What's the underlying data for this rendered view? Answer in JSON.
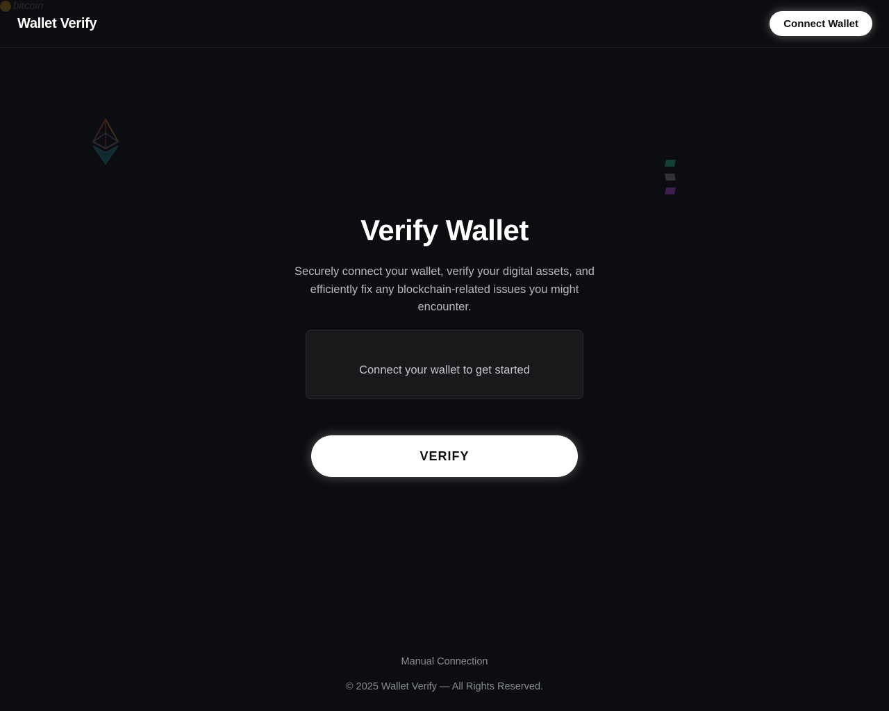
{
  "header": {
    "brand": "Wallet Verify",
    "connect_label": "Connect Wallet"
  },
  "decorations": {
    "ethereum_icon": "ethereum-logo",
    "solana_icon": "solana-logo",
    "bitcoin_icon": "bitcoin-logo",
    "bitcoin_word": "bitcoin"
  },
  "hero": {
    "title": "Verify Wallet",
    "description": "Securely connect your wallet, verify your digital assets, and efficiently fix any blockchain-related issues you might encounter.",
    "status": "Connect your wallet to get started",
    "verify_label": "VERIFY"
  },
  "footer": {
    "manual_link": "Manual Connection",
    "copyright": "© 2025 Wallet Verify — All Rights Reserved."
  },
  "colors": {
    "background": "#0c0d10",
    "card": "#19191c",
    "button": "#ffffff",
    "muted_text": "#8a8c93"
  }
}
